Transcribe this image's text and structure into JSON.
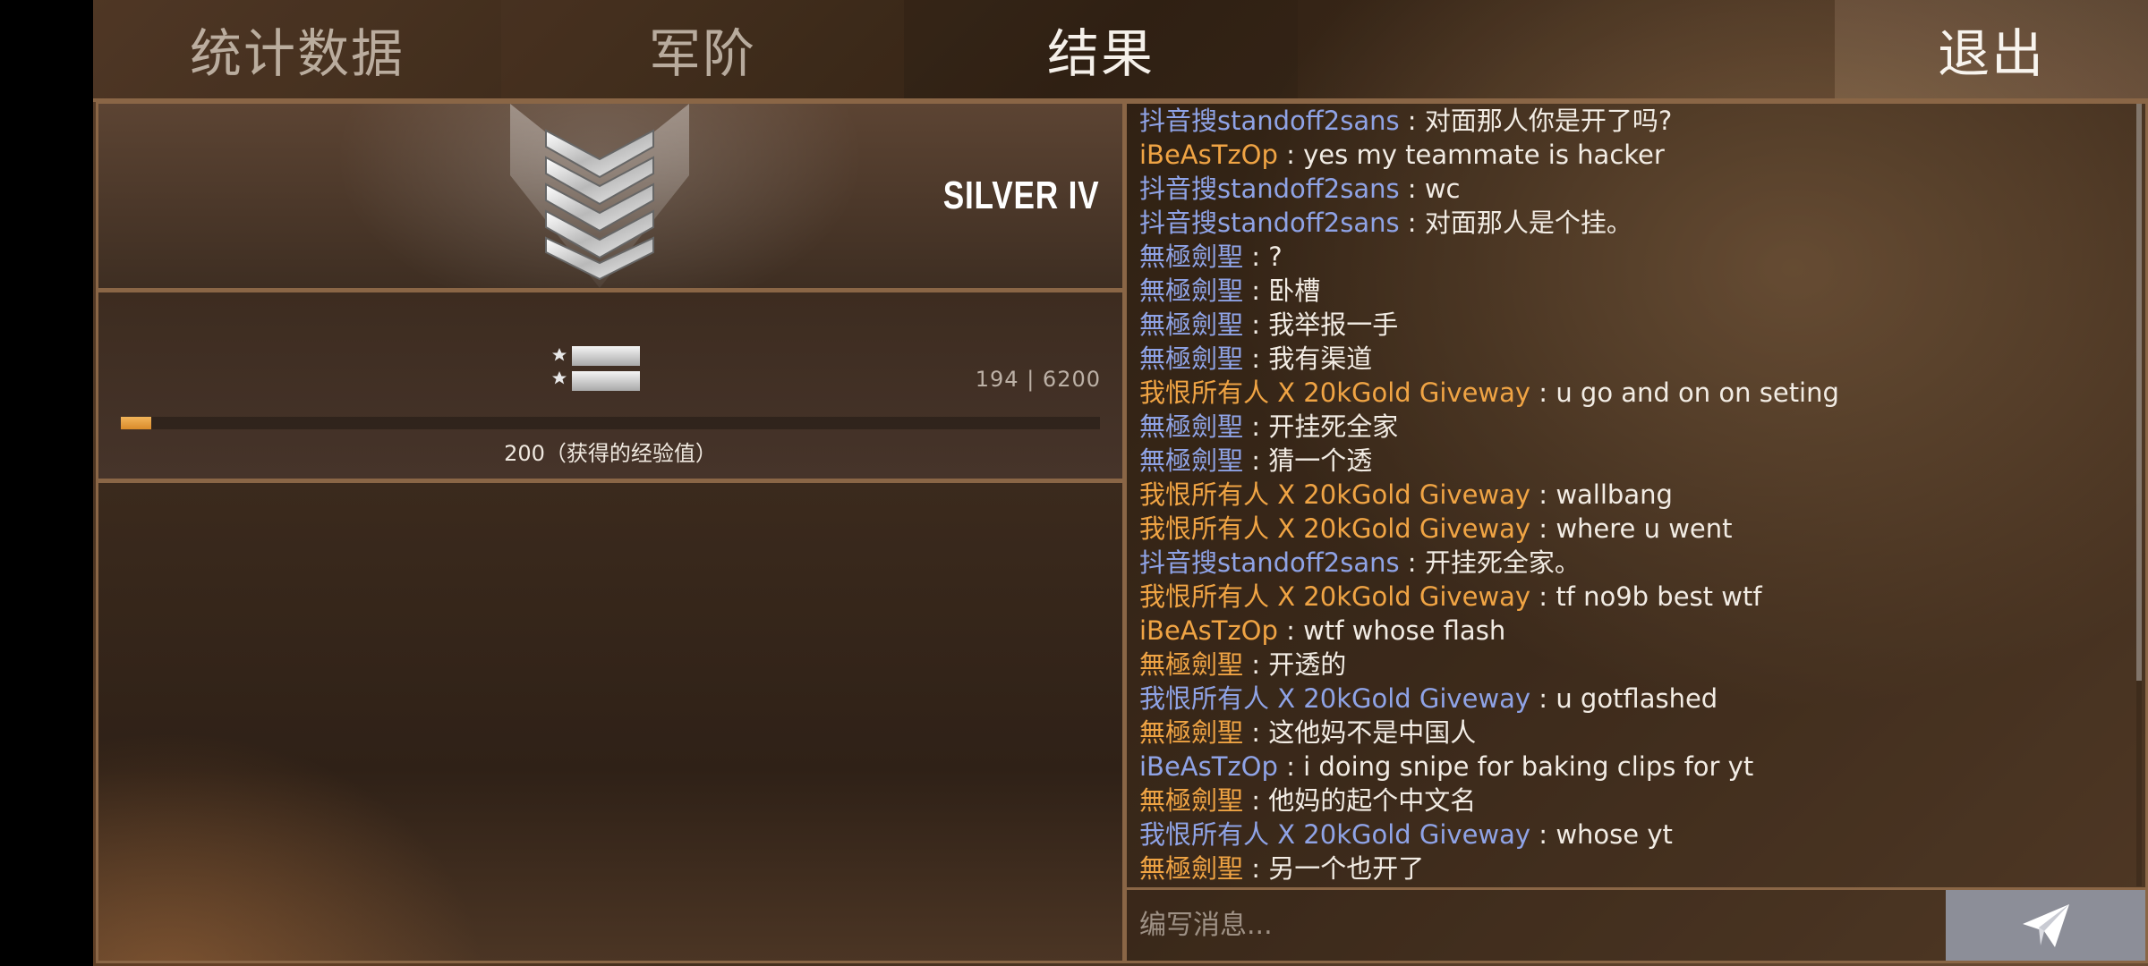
{
  "tabs": {
    "stats": "统计数据",
    "rank": "军阶",
    "results": "结果",
    "exit": "退出"
  },
  "rank_panel": {
    "rank_name": "SILVER IV",
    "emblem_icon": "silver-chevron-rank-icon"
  },
  "xp_panel": {
    "mini_emblem_icon": "next-rank-stars-bars-icon",
    "xp_count": "194 | 6200",
    "progress_fraction": 0.031,
    "xp_gained_label": "200（获得的经验值）"
  },
  "colors": {
    "author_blue": "#8fa3e6",
    "author_orange": "#f0a444",
    "progress_fill": "#e9a241",
    "border": "#8a6646"
  },
  "chat": {
    "messages": [
      {
        "author": "抖音搜standoff2sans",
        "color": "blue",
        "text": "对面那人你是开了吗?"
      },
      {
        "author": "iBeAsTzOp",
        "color": "orange",
        "text": "yes my teammate is hacker"
      },
      {
        "author": "抖音搜standoff2sans",
        "color": "blue",
        "text": "wc"
      },
      {
        "author": "抖音搜standoff2sans",
        "color": "blue",
        "text": "对面那人是个挂。"
      },
      {
        "author": "無極劍聖",
        "color": "blue",
        "text": "?"
      },
      {
        "author": "無極劍聖",
        "color": "blue",
        "text": "卧槽"
      },
      {
        "author": "無極劍聖",
        "color": "blue",
        "text": "我举报一手"
      },
      {
        "author": "無極劍聖",
        "color": "blue",
        "text": "我有渠道"
      },
      {
        "author": "我恨所有人 X 20kGold Giveway",
        "color": "orange",
        "text": "u go and on on seting"
      },
      {
        "author": "無極劍聖",
        "color": "blue",
        "text": "开挂死全家"
      },
      {
        "author": "無極劍聖",
        "color": "blue",
        "text": "猜一个透"
      },
      {
        "author": "我恨所有人 X 20kGold Giveway",
        "color": "orange",
        "text": "wallbang"
      },
      {
        "author": "我恨所有人 X 20kGold Giveway",
        "color": "orange",
        "text": "where u went"
      },
      {
        "author": "抖音搜standoff2sans",
        "color": "blue",
        "text": "开挂死全家。"
      },
      {
        "author": "我恨所有人 X 20kGold Giveway",
        "color": "orange",
        "text": "tf no9b best wtf"
      },
      {
        "author": "iBeAsTzOp",
        "color": "orange",
        "text": "wtf whose flash"
      },
      {
        "author": "無極劍聖",
        "color": "orange",
        "text": "开透的"
      },
      {
        "author": "我恨所有人 X 20kGold Giveway",
        "color": "blue",
        "text": "u gotflashed"
      },
      {
        "author": "無極劍聖",
        "color": "orange",
        "text": "这他妈不是中国人"
      },
      {
        "author": "iBeAsTzOp",
        "color": "blue",
        "text": "i doing snipe for baking clips for yt"
      },
      {
        "author": "無極劍聖",
        "color": "orange",
        "text": "他妈的起个中文名"
      },
      {
        "author": "我恨所有人 X 20kGold Giveway",
        "color": "blue",
        "text": "whose yt"
      },
      {
        "author": "無極劍聖",
        "color": "orange",
        "text": "另一个也开了"
      }
    ],
    "separator": " : ",
    "input_placeholder": "编写消息...",
    "send_icon": "paper-plane-send-icon"
  }
}
